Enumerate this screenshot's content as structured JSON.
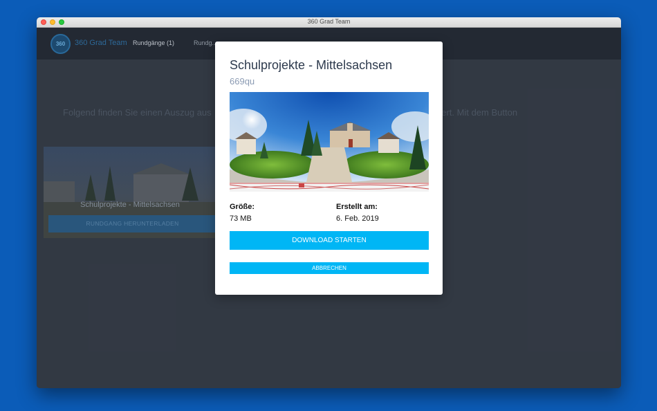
{
  "window": {
    "title": "360 Grad Team"
  },
  "navbar": {
    "logo_text": "360",
    "brand": "360 Grad Team",
    "links": [
      {
        "label": "Rundgänge (1)"
      },
      {
        "label": "Rundg..."
      }
    ]
  },
  "main": {
    "intro_start": "Folgend finden Sie einen Auszug aus",
    "intro_end": "s der Sie interessiert. Mit dem Button",
    "card": {
      "title": "Schulprojekte - Mittelsachsen",
      "button_label": "RUNDGANG HERUNTERLADEN"
    }
  },
  "modal": {
    "title": "Schulprojekte - Mittelsachsen",
    "code": "669qu",
    "size_label": "Größe:",
    "size_value": "73 MB",
    "created_label": "Erstellt am:",
    "created_value": "6. Feb. 2019",
    "download_label": "DOWNLOAD STARTEN",
    "cancel_label": "ABBRECHEN"
  },
  "colors": {
    "accent": "#00b6f5",
    "window_bg": "#323843",
    "navbar_bg": "#242a35",
    "desktop_bg": "#0b5cb8"
  }
}
